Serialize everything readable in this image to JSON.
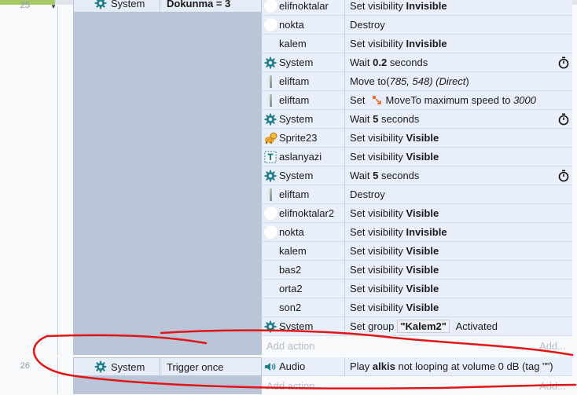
{
  "lines": {
    "top": "25",
    "bottom": "26"
  },
  "event25": {
    "condition": {
      "object": "System",
      "text": "Dokunma = 3"
    },
    "actions": [
      {
        "object": "elifnoktalar",
        "icon": "circle-icon",
        "verb": "Set visibility",
        "arg": "Invisible",
        "arg_style": "bold"
      },
      {
        "object": "nokta",
        "icon": "circle-icon",
        "verb": "Destroy",
        "arg": "",
        "arg_style": ""
      },
      {
        "object": "kalem",
        "icon": "none",
        "verb": "Set visibility",
        "arg": "Invisible",
        "arg_style": "bold"
      },
      {
        "object": "System",
        "icon": "gear-icon",
        "verb": "Wait",
        "arg": "0.2",
        "arg_style": "bold",
        "suffix": "seconds",
        "timer": true
      },
      {
        "object": "eliftam",
        "icon": "pen-icon",
        "verb": "Move to",
        "arg": "(785, 548) (Direct)",
        "arg_style": "mixed"
      },
      {
        "object": "eliftam",
        "icon": "pen-icon",
        "verb": "Set",
        "arg": "MoveTo maximum speed to",
        "arg_style": "",
        "suffix": "3000",
        "moveto_icon": true
      },
      {
        "object": "System",
        "icon": "gear-icon",
        "verb": "Wait",
        "arg": "5",
        "arg_style": "bold",
        "suffix": "seconds",
        "timer": true
      },
      {
        "object": "Sprite23",
        "icon": "sprite-icon",
        "verb": "Set visibility",
        "arg": "Visible",
        "arg_style": "bold"
      },
      {
        "object": "aslanyazi",
        "icon": "text-icon",
        "verb": "Set visibility",
        "arg": "Visible",
        "arg_style": "bold"
      },
      {
        "object": "System",
        "icon": "gear-icon",
        "verb": "Wait",
        "arg": "5",
        "arg_style": "bold",
        "suffix": "seconds",
        "timer": true
      },
      {
        "object": "eliftam",
        "icon": "pen-icon",
        "verb": "Destroy",
        "arg": "",
        "arg_style": ""
      },
      {
        "object": "elifnoktalar2",
        "icon": "circle-icon",
        "verb": "Set visibility",
        "arg": "Visible",
        "arg_style": "bold"
      },
      {
        "object": "nokta",
        "icon": "circle-icon",
        "verb": "Set visibility",
        "arg": "Invisible",
        "arg_style": "bold"
      },
      {
        "object": "kalem",
        "icon": "none",
        "verb": "Set visibility",
        "arg": "Visible",
        "arg_style": "bold"
      },
      {
        "object": "bas2",
        "icon": "none",
        "verb": "Set visibility",
        "arg": "Visible",
        "arg_style": "bold"
      },
      {
        "object": "orta2",
        "icon": "none",
        "verb": "Set visibility",
        "arg": "Visible",
        "arg_style": "bold"
      },
      {
        "object": "son2",
        "icon": "none",
        "verb": "Set visibility",
        "arg": "Visible",
        "arg_style": "bold"
      },
      {
        "object": "System",
        "icon": "gear-icon",
        "verb": "Set group",
        "arg": "\"Kalem2\"",
        "arg_style": "badge",
        "suffix": "Activated"
      }
    ],
    "add_action": "Add action",
    "add_more": "Add..."
  },
  "event26": {
    "condition": {
      "object": "System",
      "text": "Trigger once"
    },
    "action": {
      "object": "Audio",
      "verb": "Play",
      "arg": "alkis",
      "suffix": "not looping at volume 0 dB (tag \"\")"
    },
    "add_action": "Add action",
    "add_more": "Add..."
  },
  "colors": {
    "accent": "#1f7f8c",
    "annotation": "#e01515",
    "row_bg": "#e8eefa",
    "block_bg": "#bac6d8"
  }
}
